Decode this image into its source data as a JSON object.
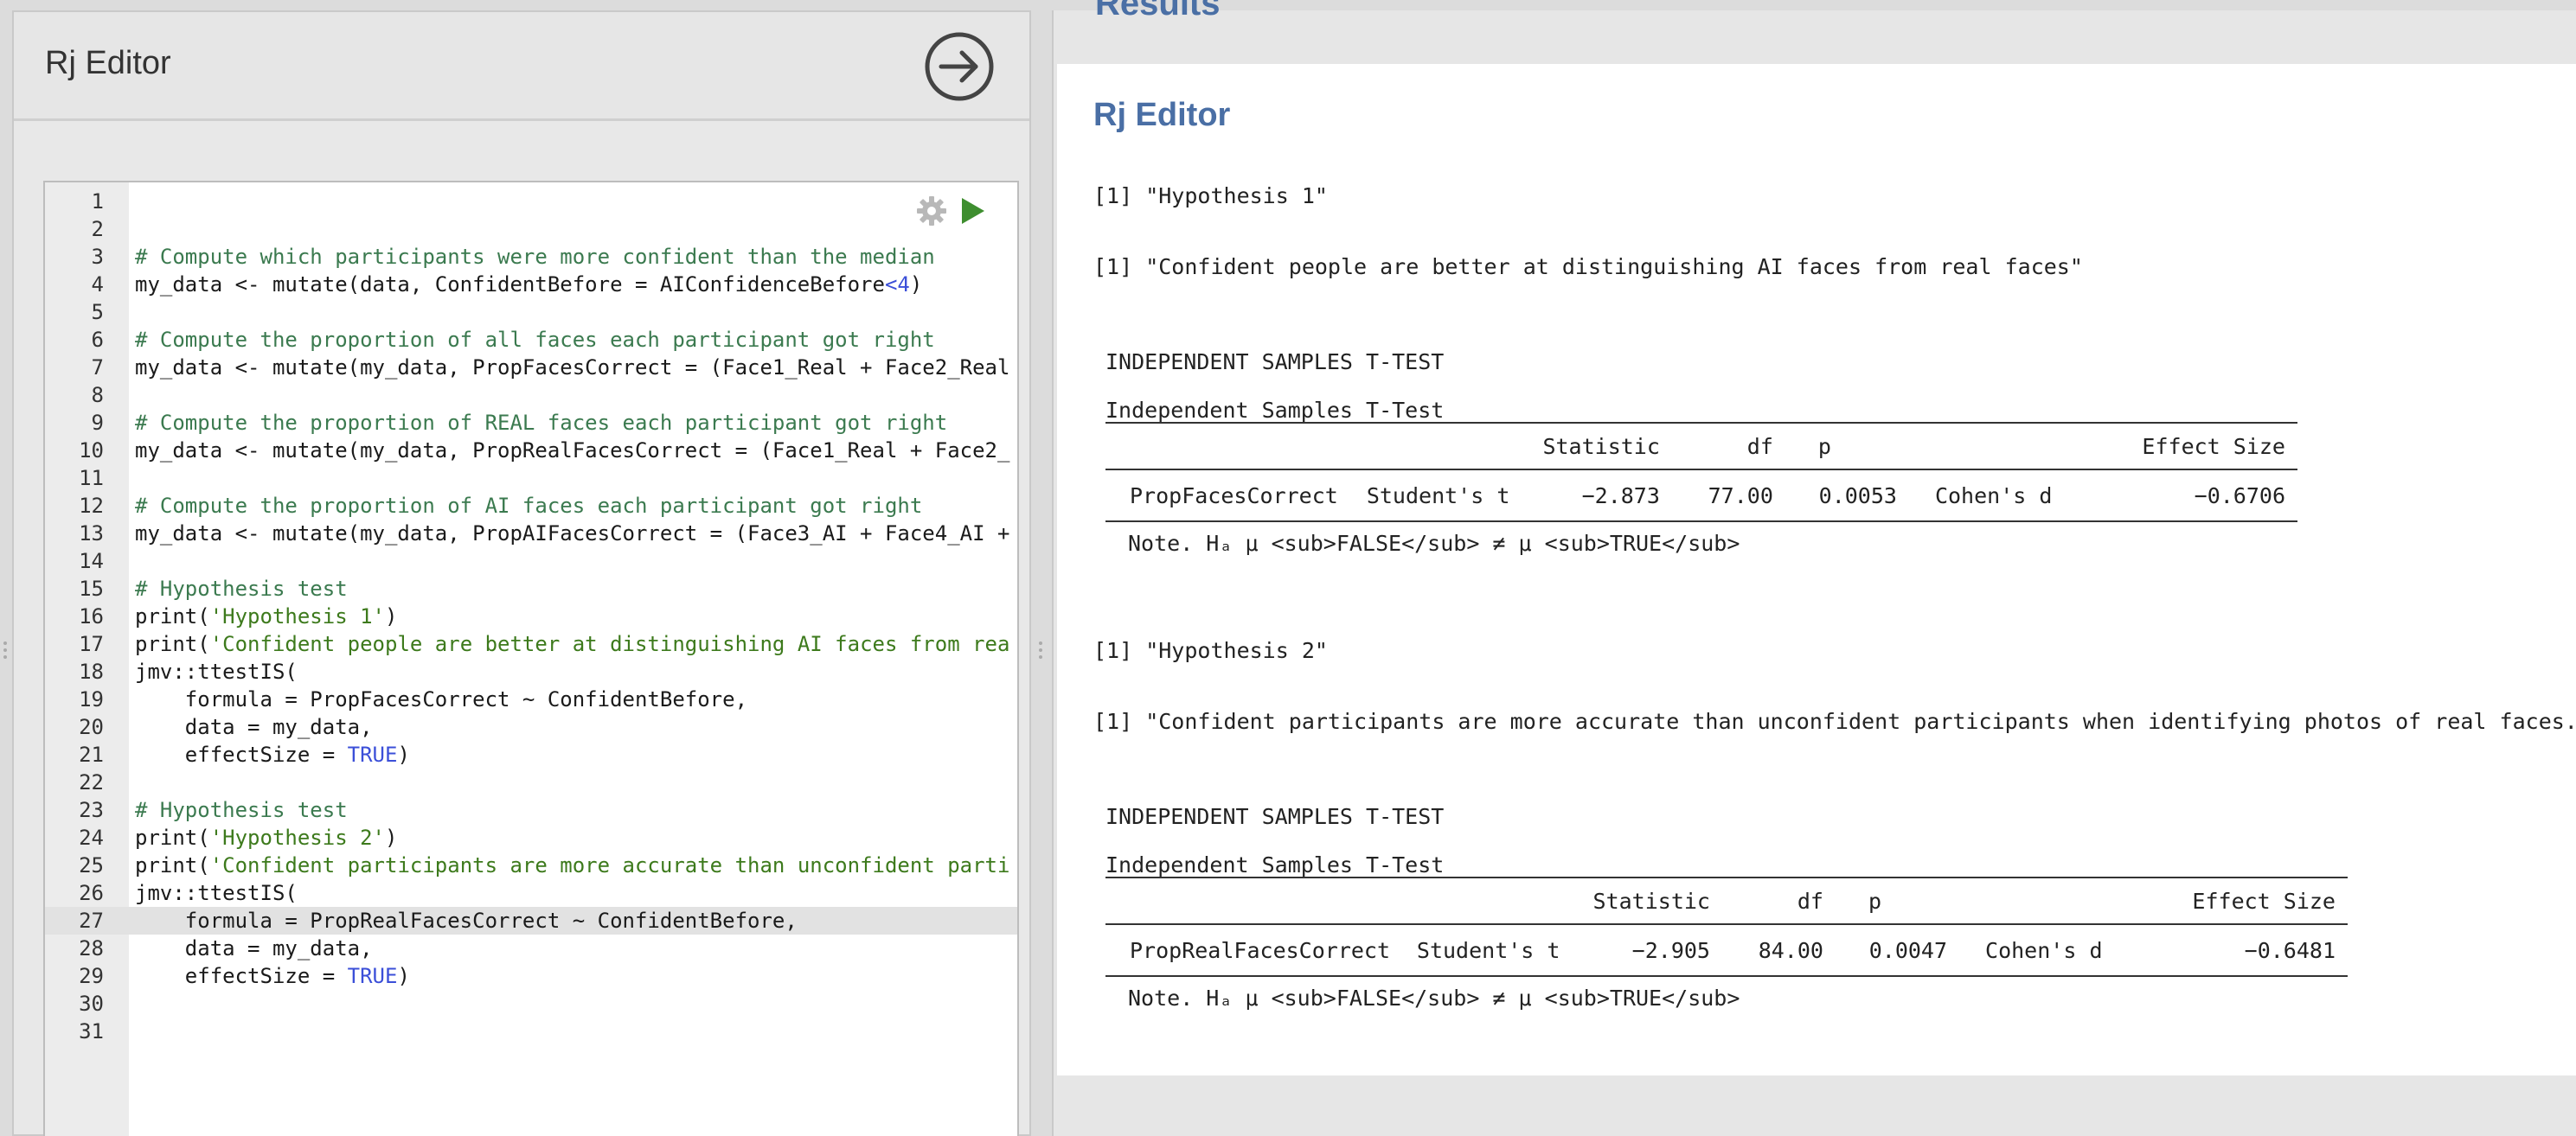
{
  "left_panel": {
    "title": "Rj Editor"
  },
  "editor": {
    "lines": [
      {
        "n": "1",
        "segs": []
      },
      {
        "n": "2",
        "segs": []
      },
      {
        "n": "3",
        "segs": [
          {
            "t": "# Compute which participants were more confident than the median",
            "c": "cm"
          }
        ]
      },
      {
        "n": "4",
        "segs": [
          {
            "t": "my_data <- mutate(data, ConfidentBefore = AIConfidenceBefore"
          },
          {
            "t": "<4",
            "c": "num"
          },
          {
            "t": ")"
          }
        ]
      },
      {
        "n": "5",
        "segs": []
      },
      {
        "n": "6",
        "segs": [
          {
            "t": "# Compute the proportion of all faces each participant got right",
            "c": "cm"
          }
        ]
      },
      {
        "n": "7",
        "segs": [
          {
            "t": "my_data <- mutate(my_data, PropFacesCorrect = (Face1_Real + Face2_Real"
          }
        ]
      },
      {
        "n": "8",
        "segs": []
      },
      {
        "n": "9",
        "segs": [
          {
            "t": "# Compute the proportion of REAL faces each participant got right",
            "c": "cm"
          }
        ]
      },
      {
        "n": "10",
        "segs": [
          {
            "t": "my_data <- mutate(my_data, PropRealFacesCorrect = (Face1_Real + Face2_"
          }
        ]
      },
      {
        "n": "11",
        "segs": []
      },
      {
        "n": "12",
        "segs": [
          {
            "t": "# Compute the proportion of AI faces each participant got right",
            "c": "cm"
          }
        ]
      },
      {
        "n": "13",
        "segs": [
          {
            "t": "my_data <- mutate(my_data, PropAIFacesCorrect = (Face3_AI + Face4_AI +"
          }
        ]
      },
      {
        "n": "14",
        "segs": []
      },
      {
        "n": "15",
        "segs": [
          {
            "t": "# Hypothesis test",
            "c": "cm"
          }
        ]
      },
      {
        "n": "16",
        "segs": [
          {
            "t": "print("
          },
          {
            "t": "'Hypothesis 1'",
            "c": "str"
          },
          {
            "t": ")"
          }
        ]
      },
      {
        "n": "17",
        "segs": [
          {
            "t": "print("
          },
          {
            "t": "'Confident people are better at distinguishing AI faces from rea",
            "c": "str"
          }
        ]
      },
      {
        "n": "18",
        "segs": [
          {
            "t": "jmv::ttestIS("
          }
        ]
      },
      {
        "n": "19",
        "segs": [
          {
            "t": "    formula = PropFacesCorrect ~ ConfidentBefore,"
          }
        ]
      },
      {
        "n": "20",
        "segs": [
          {
            "t": "    data = my_data,"
          }
        ]
      },
      {
        "n": "21",
        "segs": [
          {
            "t": "    effectSize = "
          },
          {
            "t": "TRUE",
            "c": "kw"
          },
          {
            "t": ")"
          }
        ]
      },
      {
        "n": "22",
        "segs": []
      },
      {
        "n": "23",
        "segs": [
          {
            "t": "# Hypothesis test",
            "c": "cm"
          }
        ]
      },
      {
        "n": "24",
        "segs": [
          {
            "t": "print("
          },
          {
            "t": "'Hypothesis 2'",
            "c": "str"
          },
          {
            "t": ")"
          }
        ]
      },
      {
        "n": "25",
        "segs": [
          {
            "t": "print("
          },
          {
            "t": "'Confident participants are more accurate than unconfident parti",
            "c": "str"
          }
        ]
      },
      {
        "n": "26",
        "segs": [
          {
            "t": "jmv::ttestIS("
          }
        ]
      },
      {
        "n": "27",
        "segs": [
          {
            "t": "    formula = PropRealFacesCorrect ~ ConfidentBefore,"
          }
        ]
      },
      {
        "n": "28",
        "segs": [
          {
            "t": "    data = my_data,"
          }
        ]
      },
      {
        "n": "29",
        "segs": [
          {
            "t": "    effectSize = "
          },
          {
            "t": "TRUE",
            "c": "kw"
          },
          {
            "t": ")"
          }
        ]
      },
      {
        "n": "30",
        "segs": []
      },
      {
        "n": "31",
        "segs": []
      }
    ],
    "active_line": "27"
  },
  "results": {
    "cut_heading": "Results",
    "title": "Rj Editor",
    "h1_print": "[1] \"Hypothesis 1\"",
    "h1_statement": "[1] \"Confident people are better at distinguishing AI faces from real faces\"",
    "h2_print": "[1] \"Hypothesis 2\"",
    "h2_statement": "[1] \"Confident participants are more accurate than unconfident participants when identifying photos of real faces.\"",
    "section_heading": "INDEPENDENT SAMPLES T-TEST",
    "table_caption": "Independent Samples T-Test",
    "columns": {
      "statistic": "Statistic",
      "df": "df",
      "p": "p",
      "effect": "Effect Size"
    },
    "test1": {
      "var": "PropFacesCorrect",
      "test": "Student's t",
      "statistic": "−2.873",
      "df": "77.00",
      "p": "0.0053",
      "effect_name": "Cohen's d",
      "effect_value": "−0.6706"
    },
    "test2": {
      "var": "PropRealFacesCorrect",
      "test": "Student's t",
      "statistic": "−2.905",
      "df": "84.00",
      "p": "0.0047",
      "effect_name": "Cohen's d",
      "effect_value": "−0.6481"
    },
    "note": "Note. Hₐ μ <sub>FALSE</sub> ≠ μ <sub>TRUE</sub>"
  },
  "colors": {
    "accent_blue": "#4a6fa5",
    "comment_green": "#3b7a4f",
    "string_green": "#3d7a1c",
    "keyword_blue": "#3b4fd8",
    "run_green": "#3e8e2f"
  },
  "icons": {
    "run_arrow": "arrow-right-circle-icon",
    "gear": "gear-icon",
    "play": "play-icon"
  }
}
